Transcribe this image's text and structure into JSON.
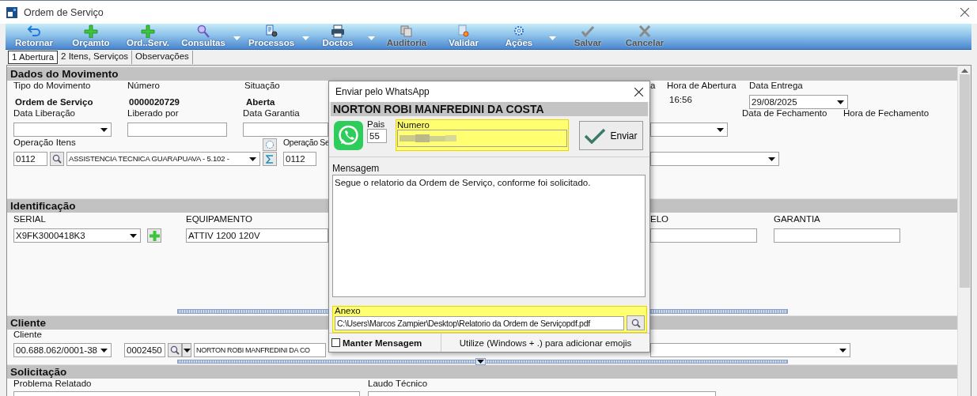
{
  "window": {
    "title": "Ordem de Serviço"
  },
  "toolbar": [
    {
      "label": "Retornar",
      "kind": "undo",
      "disabled": false,
      "dropdown": false
    },
    {
      "label": "Orçamto",
      "kind": "plus",
      "disabled": false,
      "dropdown": false
    },
    {
      "label": "Ord..Serv.",
      "kind": "plus",
      "disabled": false,
      "dropdown": false
    },
    {
      "label": "Consultas",
      "kind": "search",
      "disabled": false,
      "dropdown": true
    },
    {
      "label": "Processos",
      "kind": "process",
      "disabled": false,
      "dropdown": true
    },
    {
      "label": "Doctos",
      "kind": "printer",
      "disabled": false,
      "dropdown": true
    },
    {
      "label": "Auditoria",
      "kind": "copy",
      "disabled": true,
      "dropdown": false
    },
    {
      "label": "Validar",
      "kind": "validate",
      "disabled": false,
      "dropdown": false
    },
    {
      "label": "Ações",
      "kind": "gear",
      "disabled": false,
      "dropdown": true
    },
    {
      "label": "Salvar",
      "kind": "check",
      "disabled": true,
      "dropdown": false
    },
    {
      "label": "Cancelar",
      "kind": "cross",
      "disabled": true,
      "dropdown": false
    }
  ],
  "tabs": [
    {
      "label": "1 Abertura",
      "selected": true
    },
    {
      "label": "2 Itens, Serviços",
      "selected": false
    },
    {
      "label": "Observações",
      "selected": false
    }
  ],
  "dados_do_movimento": {
    "title": "Dados do Movimento",
    "tipo_do_movimento": {
      "label": "Tipo do Movimento",
      "value": "Ordem de Serviço"
    },
    "numero": {
      "label": "Número",
      "value": "0000020729"
    },
    "situacao": {
      "label": "Situação",
      "value": "Aberta"
    },
    "cut_label": "a",
    "hora_de_abertura": {
      "label": "Hora de Abertura",
      "value": "16:56"
    },
    "data_entrega": {
      "label": "Data Entrega",
      "value": "29/08/2025"
    },
    "data_liberacao": {
      "label": "Data Liberação"
    },
    "liberado_por": {
      "label": "Liberado por"
    },
    "data_garantia": {
      "label": "Data Garantia"
    },
    "data_de_fechamento": {
      "label": "Data de Fechamento"
    },
    "hora_de_fechamento": {
      "label": "Hora de Fechamento"
    },
    "operacao_itens": {
      "label": "Operação Itens",
      "code": "0112",
      "description": "ASSISTENCIA TECNICA GUARAPUAVA - 5.102 -"
    },
    "operacao_cut": {
      "label": "Operação Se",
      "code": "0112"
    }
  },
  "identificacao": {
    "title": "Identificação",
    "serial": {
      "label": "SERIAL",
      "value": "X9FK3000418K3"
    },
    "equipamento": {
      "label": "EQUIPAMENTO",
      "value": "ATTIV 1200 120V"
    },
    "cut_label": "ELO",
    "garantia": {
      "label": "GARANTIA"
    }
  },
  "cliente": {
    "title": "Cliente",
    "label": "Cliente",
    "document": "00.688.062/0001-38",
    "code": "0002450",
    "name": "NORTON ROBI MANFREDINI DA CO"
  },
  "solicitacao": {
    "title": "Solicitação",
    "problema_label": "Problema Relatado",
    "laudo_label": "Laudo Técnico"
  },
  "dialog": {
    "title": "Enviar pelo WhatsApp",
    "contact": "NORTON ROBI MANFREDINI DA COSTA",
    "country_label": "Pais",
    "country": "55",
    "number_label": "Numero",
    "number_highlighted": true,
    "send_button": "Enviar",
    "message_label": "Mensagem",
    "message": "Segue o relatorio da Ordem de Serviço, conforme foi solicitado.",
    "attachment_label": "Anexo",
    "attachment": "C:\\Users\\Marcos Zampier\\Desktop\\Relatorio da Ordem de Serviçopdf.pdf",
    "attachment_highlighted": true,
    "keep_message": {
      "label": "Manter Mensagem",
      "checked": false
    },
    "emoji_hint": "Utilize (Windows + .) para adicionar emojis"
  }
}
